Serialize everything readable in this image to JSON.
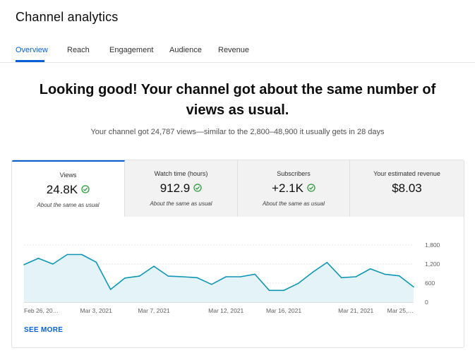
{
  "page": {
    "title": "Channel analytics"
  },
  "tabs": [
    {
      "label": "Overview",
      "active": true
    },
    {
      "label": "Reach",
      "active": false
    },
    {
      "label": "Engagement",
      "active": false
    },
    {
      "label": "Audience",
      "active": false
    },
    {
      "label": "Revenue",
      "active": false
    }
  ],
  "summary": {
    "headline_line1": "Looking good! Your channel got about the same number of",
    "headline_line2": "views as usual.",
    "subline": "Your channel got 24,787 views—similar to the 2,800–48,900 it usually gets in 28 days"
  },
  "metrics": [
    {
      "label": "Views",
      "value": "24.8K",
      "note": "About the same as usual",
      "status_icon": "check-circle-icon"
    },
    {
      "label": "Watch time (hours)",
      "value": "912.9",
      "note": "About the same as usual",
      "status_icon": "check-circle-icon"
    },
    {
      "label": "Subscribers",
      "value": "+2.1K",
      "note": "About the same as usual",
      "status_icon": "check-circle-icon"
    },
    {
      "label": "Your estimated revenue",
      "value": "$8.03",
      "note": "",
      "status_icon": ""
    }
  ],
  "colors": {
    "accent": "#065fd4",
    "chart_line": "#0f96b3",
    "chart_fill": "#e4f3f8",
    "check_green": "#2e9b3e"
  },
  "chart_data": {
    "type": "area",
    "x": [
      "Feb 26",
      "Feb 27",
      "Feb 28",
      "Mar 1",
      "Mar 2",
      "Mar 3",
      "Mar 4",
      "Mar 5",
      "Mar 6",
      "Mar 7",
      "Mar 8",
      "Mar 9",
      "Mar 10",
      "Mar 11",
      "Mar 12",
      "Mar 13",
      "Mar 14",
      "Mar 15",
      "Mar 16",
      "Mar 17",
      "Mar 18",
      "Mar 19",
      "Mar 20",
      "Mar 21",
      "Mar 22",
      "Mar 23",
      "Mar 24",
      "Mar 25"
    ],
    "values": [
      1180,
      1380,
      1200,
      1500,
      1500,
      1260,
      400,
      760,
      820,
      1130,
      820,
      800,
      770,
      560,
      800,
      800,
      880,
      370,
      370,
      590,
      940,
      1250,
      770,
      800,
      1050,
      880,
      830,
      480
    ],
    "ylim": [
      0,
      1800
    ],
    "yticks": [
      "1,800",
      "1,200",
      "600",
      "0"
    ],
    "ytick_values": [
      1800,
      1200,
      600,
      0
    ],
    "xtick_labels": [
      "Feb 26, 20…",
      "Mar 3, 2021",
      "Mar 7, 2021",
      "Mar 12, 2021",
      "Mar 16, 2021",
      "Mar 21, 2021",
      "Mar 25,…"
    ],
    "xtick_indices": [
      0,
      5,
      9,
      14,
      18,
      23,
      27
    ],
    "grid": true
  },
  "see_more": "SEE MORE"
}
